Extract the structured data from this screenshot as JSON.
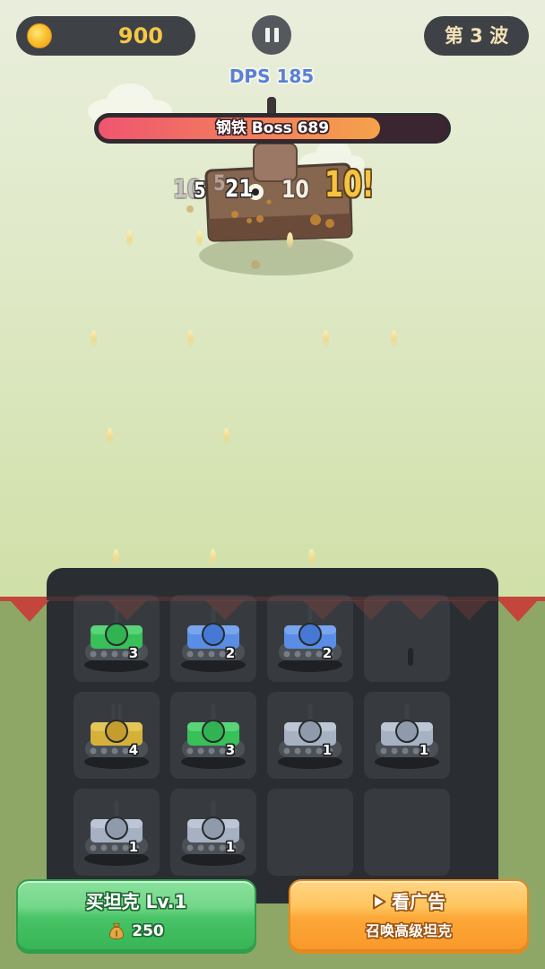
{
  "hud": {
    "coin_icon": "coin-icon",
    "coins": "900",
    "pause_icon": "pause-icon",
    "wave": "第 3 波"
  },
  "dps": "DPS 185",
  "boss": {
    "label": "钢铁 Boss 689",
    "health_fraction": 0.81
  },
  "damage_popups": [
    "10",
    "5",
    "5",
    "21",
    "10",
    "10!"
  ],
  "grid": {
    "cells": [
      {
        "tank": "green",
        "level": "3"
      },
      {
        "tank": "blue",
        "level": "2"
      },
      {
        "tank": "blue",
        "level": "2"
      },
      {
        "tank": null,
        "level": null
      },
      {
        "tank": "yellow",
        "level": "4"
      },
      {
        "tank": "green",
        "level": "3"
      },
      {
        "tank": "gray",
        "level": "1"
      },
      {
        "tank": "gray",
        "level": "1"
      },
      {
        "tank": "gray",
        "level": "1"
      },
      {
        "tank": "gray",
        "level": "1"
      },
      {
        "tank": null,
        "level": null
      },
      {
        "tank": null,
        "level": null
      }
    ]
  },
  "tank_colors": {
    "green": {
      "body": "#38c059",
      "top": "#5ad478",
      "turret": "#31b351"
    },
    "blue": {
      "body": "#5a8ee6",
      "top": "#78a5ee",
      "turret": "#4678d6"
    },
    "gray": {
      "body": "#a6b1c2",
      "top": "#bcc6d4",
      "turret": "#8f9bad"
    },
    "yellow": {
      "body": "#d6b13a",
      "top": "#e4c557",
      "turret": "#c69c2c"
    }
  },
  "colors": {
    "coin_text": "#f6c744",
    "dps_text": "#5a7fd6",
    "wave_text": "#f3e1b6",
    "health_fill_start": "#ef5570",
    "health_fill_end": "#f5a24a",
    "buy_button": "#3dbb5a",
    "ad_button": "#f99d2c"
  },
  "buttons": {
    "buy": {
      "label": "买坦克 Lv.1",
      "icon": "money-bag-icon",
      "cost": "250"
    },
    "ad": {
      "icon": "play-icon",
      "label": "看广告",
      "sublabel": "召唤高级坦克"
    }
  }
}
